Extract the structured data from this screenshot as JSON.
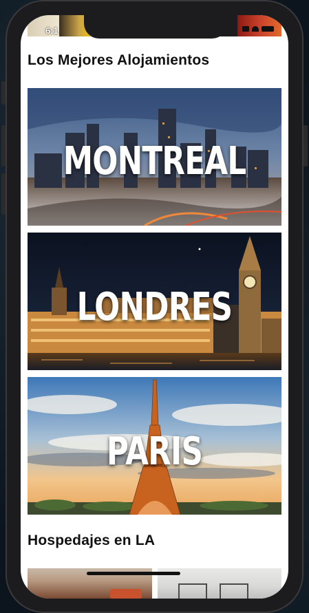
{
  "status_bar": {
    "time": "6:1"
  },
  "sections": {
    "best_title": "Los Mejores Alojamientos",
    "la_title": "Hospedajes en LA"
  },
  "cities": [
    {
      "name": "MONTREAL"
    },
    {
      "name": "LONDRES"
    },
    {
      "name": "PARIS"
    }
  ]
}
